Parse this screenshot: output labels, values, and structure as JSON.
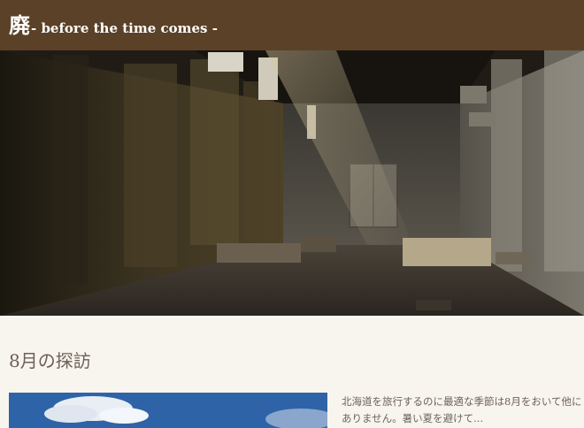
{
  "site": {
    "logo_kanji": "廃",
    "logo_subtitle": "- before the time comes -"
  },
  "colors": {
    "header_bg": "#5a4127",
    "page_bg": "#f8f4ee",
    "title_text": "#6b6056",
    "body_text": "#6d635a"
  },
  "hero": {
    "image": "abandoned-industrial-hall-photo"
  },
  "article": {
    "title": "8月の探訪",
    "thumbnail": "sky-clouds-photo",
    "lines": [
      "北海道を旅行するのに最適な季節は8月をおいて他に",
      "ありません。暑い夏を避けて..."
    ]
  }
}
